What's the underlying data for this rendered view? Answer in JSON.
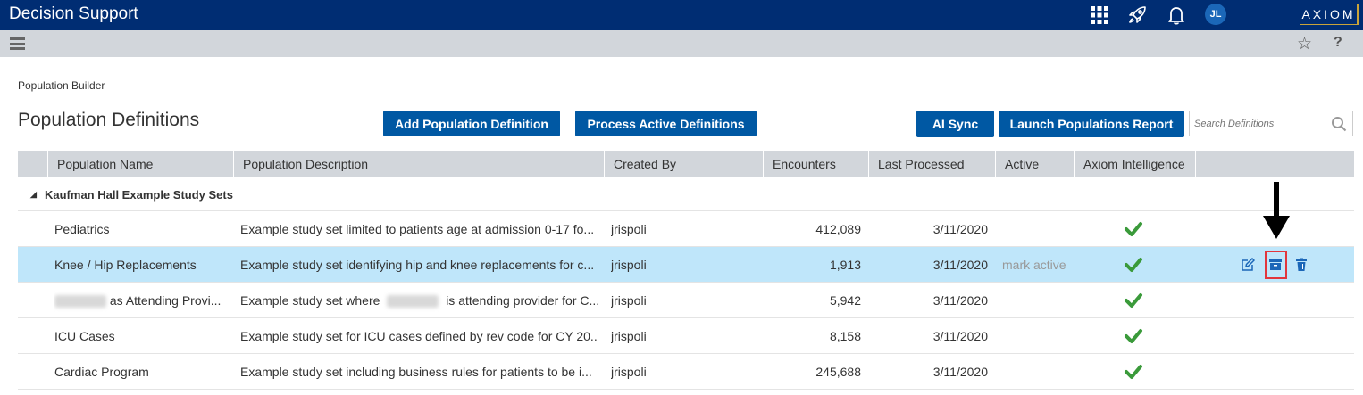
{
  "app": {
    "title": "Decision Support",
    "brand": "AXIOM",
    "avatar_initials": "JL"
  },
  "topbar_icons": [
    "apps-grid-icon",
    "rocket-icon",
    "bell-icon"
  ],
  "subbar_icons": [
    "hamburger-menu-icon",
    "star-icon",
    "help-icon"
  ],
  "help_label": "?",
  "breadcrumb": "Population Builder",
  "page_title": "Population Definitions",
  "buttons": {
    "add": "Add Population Definition",
    "process": "Process Active Definitions",
    "ai_sync": "AI Sync",
    "launch": "Launch Populations Report"
  },
  "search": {
    "placeholder": "Search Definitions"
  },
  "table": {
    "columns": [
      "Population Name",
      "Population Description",
      "Created By",
      "Encounters",
      "Last Processed",
      "Active",
      "Axiom Intelligence"
    ],
    "group": "Kaufman Hall Example Study Sets",
    "rows": [
      {
        "name": "Pediatrics",
        "description": "Example study set limited to patients age at admission 0-17 fo...",
        "created_by": "jrispoli",
        "encounters": "412,089",
        "last_processed": "3/11/2020",
        "active": ""
      },
      {
        "name": "Knee / Hip Replacements",
        "description": "Example study set identifying hip and knee replacements for c...",
        "created_by": "jrispoli",
        "encounters": "1,913",
        "last_processed": "3/11/2020",
        "active": "mark active"
      },
      {
        "name": "as Attending Provi...",
        "description_prefix": "Example study set where",
        "description_suffix": "is attending provider for C...",
        "created_by": "jrispoli",
        "encounters": "5,942",
        "last_processed": "3/11/2020",
        "active": ""
      },
      {
        "name": "ICU Cases",
        "description": "Example study set for ICU cases defined by rev code for CY 20...",
        "created_by": "jrispoli",
        "encounters": "8,158",
        "last_processed": "3/11/2020",
        "active": ""
      },
      {
        "name": "Cardiac Program",
        "description": "Example study set including business rules for patients to be i...",
        "created_by": "jrispoli",
        "encounters": "245,688",
        "last_processed": "3/11/2020",
        "active": ""
      }
    ]
  },
  "colors": {
    "topbar": "#002d73",
    "button": "#0058a3",
    "selected_row": "#bfe6fa",
    "check": "#3a9a3a",
    "highlight": "#e2363c",
    "brand_accent": "#c9a43a"
  }
}
